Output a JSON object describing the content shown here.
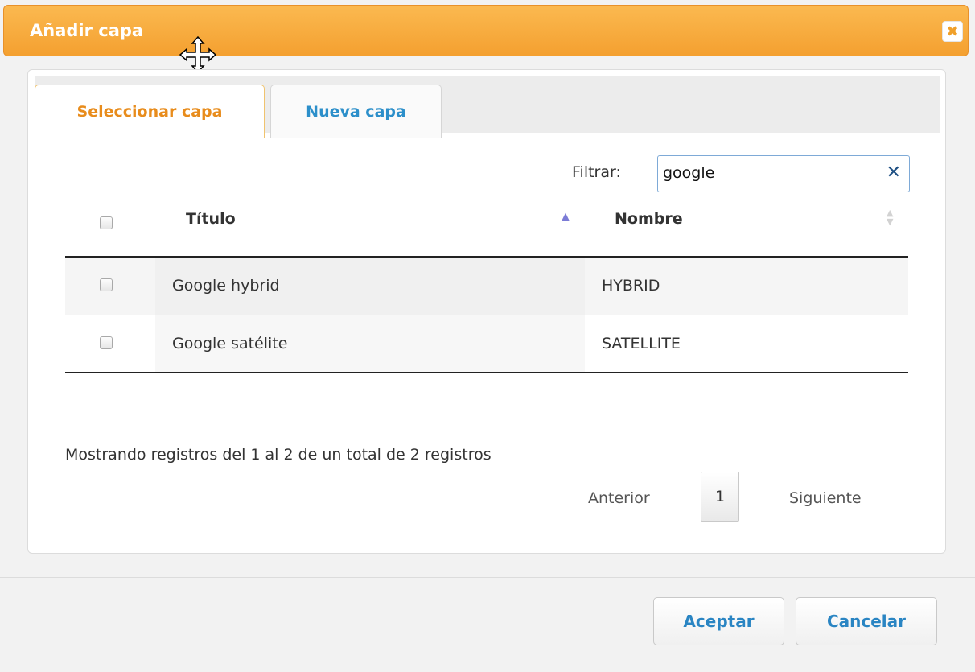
{
  "dialog": {
    "title": "Añadir capa",
    "close_icon": "close-icon",
    "move_cursor_icon": "move-cursor-icon"
  },
  "tabs": [
    {
      "label": "Seleccionar capa",
      "active": true
    },
    {
      "label": "Nueva capa",
      "active": false
    }
  ],
  "filter": {
    "label": "Filtrar:",
    "value": "google",
    "clear_icon": "clear-icon"
  },
  "table": {
    "columns": [
      {
        "label": "Título",
        "sort": "ascending"
      },
      {
        "label": "Nombre",
        "sort": "none"
      }
    ],
    "rows": [
      {
        "titulo": "Google hybrid",
        "nombre": "HYBRID",
        "checked": false
      },
      {
        "titulo": "Google satélite",
        "nombre": "SATELLITE",
        "checked": false
      }
    ]
  },
  "info": "Mostrando registros del 1 al 2 de un total de 2 registros",
  "pagination": {
    "prev": "Anterior",
    "current": "1",
    "next": "Siguiente"
  },
  "buttons": {
    "accept": "Aceptar",
    "cancel": "Cancelar"
  },
  "colors": {
    "titlebar": "#f4a030",
    "active_tab_text": "#e88c1c",
    "link_blue": "#2c8fca"
  }
}
